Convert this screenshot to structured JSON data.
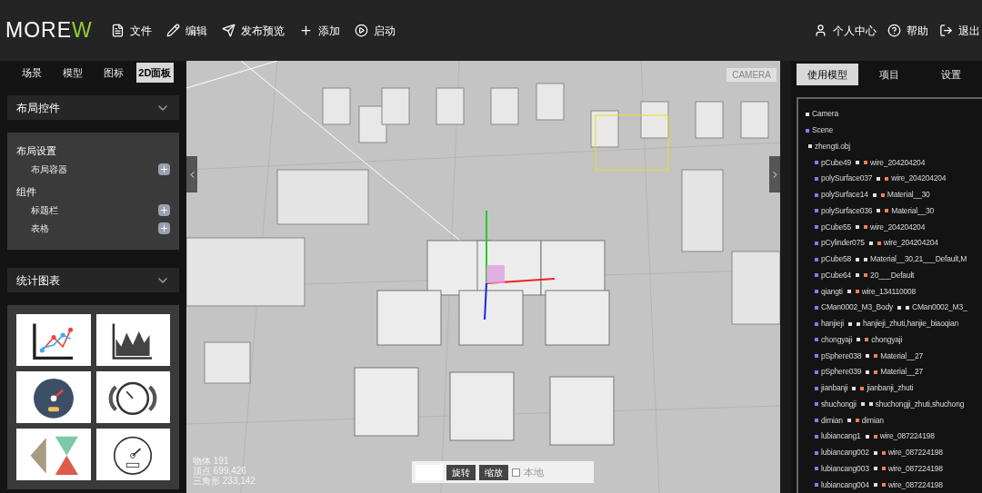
{
  "header": {
    "logo": {
      "main": "MORE",
      "accent": "W"
    },
    "menu": [
      {
        "label": "文件"
      },
      {
        "label": "编辑"
      },
      {
        "label": "发布预览"
      },
      {
        "label": "添加"
      },
      {
        "label": "启动"
      }
    ],
    "user_menu": [
      {
        "label": "个人中心"
      },
      {
        "label": "帮助"
      },
      {
        "label": "退出"
      }
    ]
  },
  "left_panel": {
    "tabs": [
      {
        "label": "场景",
        "selected": false
      },
      {
        "label": "模型",
        "selected": false
      },
      {
        "label": "图标",
        "selected": false
      },
      {
        "label": "2D面板",
        "selected": true
      }
    ],
    "sections": [
      {
        "kind": "list",
        "title": "布局控件",
        "expanded": true,
        "groups": [
          {
            "title": "布局设置",
            "items": [
              "布局容器"
            ]
          },
          {
            "title": "组件",
            "items": [
              "标题栏",
              "表格"
            ]
          }
        ]
      },
      {
        "kind": "charts",
        "title": "统计图表",
        "expanded": true
      }
    ]
  },
  "viewport": {
    "camera_label": "CAMERA",
    "stats": [
      "物体 191",
      "顶点 699,426",
      "三角形 233,142"
    ],
    "toolbar": {
      "buttons": [
        {
          "label": "旋转"
        },
        {
          "label": "缩放"
        }
      ],
      "local": {
        "label": "本地",
        "checked": false
      }
    }
  },
  "right_panel": {
    "tabs": [
      {
        "label": "使用模型",
        "selected": true
      },
      {
        "label": "项目",
        "selected": false
      },
      {
        "label": "设置",
        "selected": false
      }
    ],
    "tree": [
      {
        "label": "Camera",
        "color": "#e0e0e0"
      },
      {
        "label": "Scene",
        "color": "#8080f0",
        "children": [
          {
            "label": "zhengti.obj",
            "color": "#e0e0e0",
            "children": [
              {
                "label": "pCube49",
                "color": "#8080f0",
                "material": {
                  "label": "wire_204204204",
                  "color": "#f08050"
                }
              },
              {
                "label": "polySurface037",
                "color": "#8080f0",
                "material": {
                  "label": "wire_204204204",
                  "color": "#f08050"
                }
              },
              {
                "label": "polySurface14",
                "color": "#8080f0",
                "material": {
                  "label": "Material__30",
                  "color": "#f08050"
                }
              },
              {
                "label": "polySurface036",
                "color": "#8080f0",
                "material": {
                  "label": "Material__30",
                  "color": "#f08050"
                }
              },
              {
                "label": "pCube55",
                "color": "#8080f0",
                "material": {
                  "label": "wire_204204204",
                  "color": "#f08050"
                }
              },
              {
                "label": "pCylinder075",
                "color": "#8080f0",
                "material": {
                  "label": "wire_204204204",
                  "color": "#f08050"
                }
              },
              {
                "label": "pCube58",
                "color": "#8080f0",
                "material": {
                  "label": "Material__30,21___Default,M",
                  "color": "#e0e0e0"
                }
              },
              {
                "label": "pCube64",
                "color": "#8080f0",
                "material": {
                  "label": "20___Default",
                  "color": "#f08050"
                }
              },
              {
                "label": "qiangti",
                "color": "#8080f0",
                "material": {
                  "label": "wire_134110008",
                  "color": "#f08050"
                }
              },
              {
                "label": "CMan0002_M3_Body",
                "color": "#8080f0",
                "material": {
                  "label": "CMan0002_M3_",
                  "color": "#e0e0e0"
                }
              },
              {
                "label": "hanjieji",
                "color": "#8080f0",
                "material": {
                  "label": "hanjieji_zhuti,hanjie_biaoqian",
                  "color": "#e0e0e0"
                }
              },
              {
                "label": "chongyaji",
                "color": "#8080f0",
                "material": {
                  "label": "chongyaji",
                  "color": "#f08050"
                }
              },
              {
                "label": "pSphere038",
                "color": "#8080f0",
                "material": {
                  "label": "Material__27",
                  "color": "#f08050"
                }
              },
              {
                "label": "pSphere039",
                "color": "#8080f0",
                "material": {
                  "label": "Material__27",
                  "color": "#f08050"
                }
              },
              {
                "label": "jianbanji",
                "color": "#8080f0",
                "material": {
                  "label": "jianbanji_zhuti",
                  "color": "#f08050"
                }
              },
              {
                "label": "shuchongji",
                "color": "#8080f0",
                "material": {
                  "label": "shuchongji_zhuti,shuchong",
                  "color": "#e0e0e0"
                }
              },
              {
                "label": "dimian",
                "color": "#8080f0",
                "material": {
                  "label": "dimian",
                  "color": "#f08050"
                }
              },
              {
                "label": "lubiancang1",
                "color": "#8080f0",
                "material": {
                  "label": "wire_087224198",
                  "color": "#f08050"
                }
              },
              {
                "label": "lubiancang002",
                "color": "#8080f0",
                "material": {
                  "label": "wire_087224198",
                  "color": "#f08050"
                }
              },
              {
                "label": "lubiancang003",
                "color": "#8080f0",
                "material": {
                  "label": "wire_087224198",
                  "color": "#f08050"
                }
              },
              {
                "label": "lubiancang004",
                "color": "#8080f0",
                "material": {
                  "label": "wire_087224198",
                  "color": "#f08050"
                }
              }
            ]
          }
        ]
      }
    ]
  }
}
